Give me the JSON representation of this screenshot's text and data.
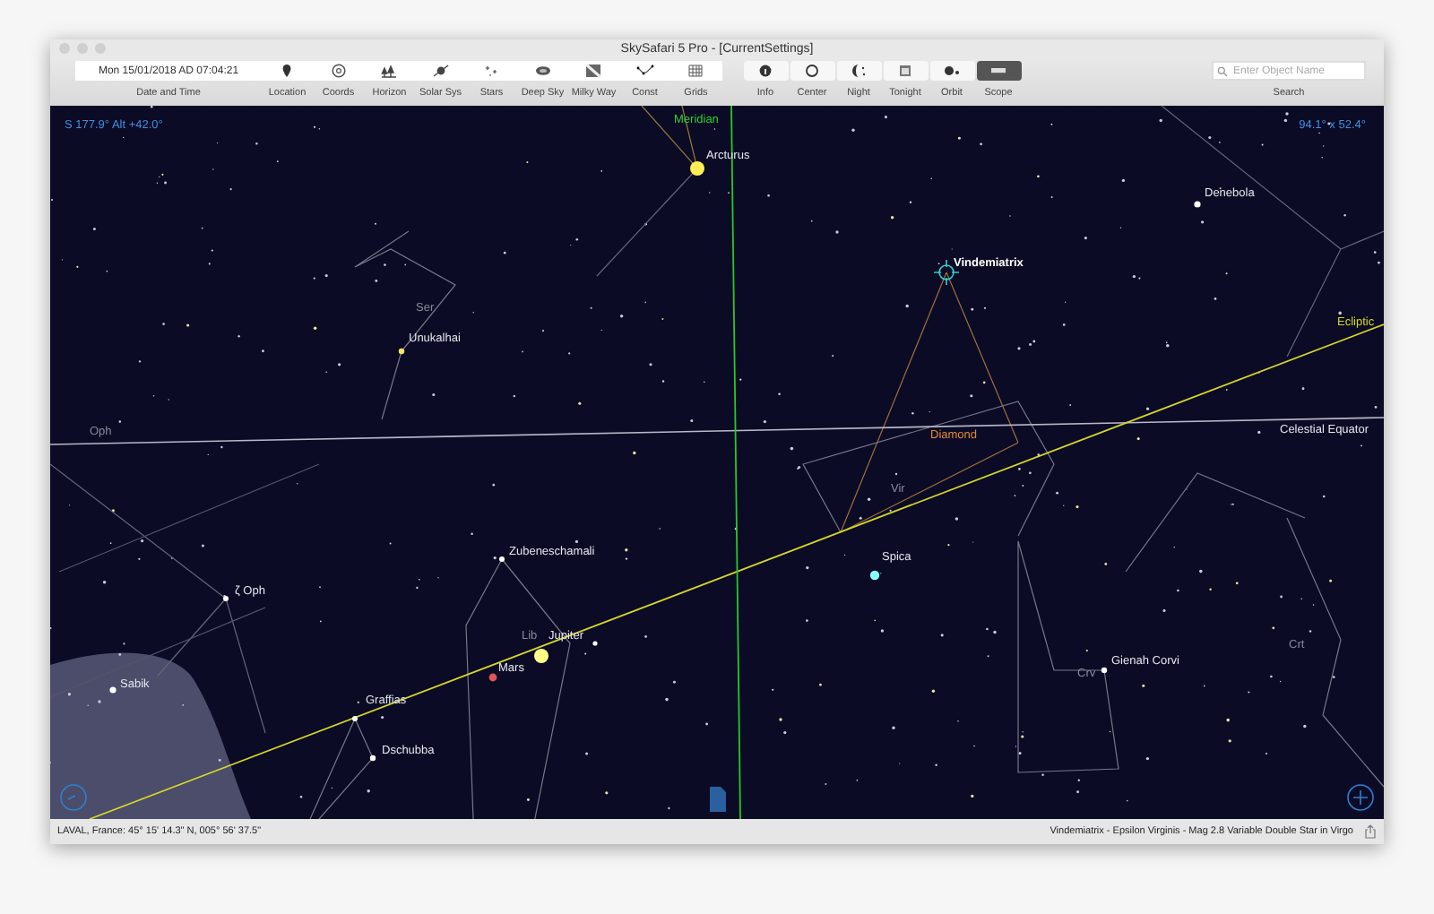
{
  "window": {
    "title": "SkySafari 5 Pro - [CurrentSettings]"
  },
  "toolbar": {
    "date_time": {
      "value": "Mon 15/01/2018 AD 07:04:21",
      "label": "Date and Time"
    },
    "view_buttons": [
      {
        "label": "Location",
        "selected": false
      },
      {
        "label": "Coords",
        "selected": false
      },
      {
        "label": "Horizon",
        "selected": false
      },
      {
        "label": "Solar Sys",
        "selected": false
      },
      {
        "label": "Stars",
        "selected": false
      },
      {
        "label": "Deep Sky",
        "selected": false
      },
      {
        "label": "Milky Way",
        "selected": false
      },
      {
        "label": "Const",
        "selected": false
      },
      {
        "label": "Grids",
        "selected": false
      }
    ],
    "tool_buttons": [
      {
        "label": "Info",
        "selected": false
      },
      {
        "label": "Center",
        "selected": false
      },
      {
        "label": "Night",
        "selected": false
      },
      {
        "label": "Tonight",
        "selected": false
      },
      {
        "label": "Orbit",
        "selected": false
      },
      {
        "label": "Scope",
        "selected": true
      }
    ],
    "search": {
      "placeholder": "Enter Object Name",
      "label": "Search"
    }
  },
  "sky": {
    "orientation": "S 177.9° Alt +42.0°",
    "field_of_view": "94.1° x 52.4°",
    "labels": [
      {
        "text": "Meridian",
        "kind": "meridian"
      },
      {
        "text": "Arcturus",
        "kind": "star"
      },
      {
        "text": "Denebola",
        "kind": "star"
      },
      {
        "text": "Vindemiatrix",
        "kind": "target"
      },
      {
        "text": "Ser",
        "kind": "constellation"
      },
      {
        "text": "Unukalhai",
        "kind": "star"
      },
      {
        "text": "Ecliptic",
        "kind": "ecliptic"
      },
      {
        "text": "Oph",
        "kind": "constellation"
      },
      {
        "text": "Diamond",
        "kind": "asterism"
      },
      {
        "text": "Celestial Equator",
        "kind": "equator"
      },
      {
        "text": "Vir",
        "kind": "constellation"
      },
      {
        "text": "ζ Oph",
        "kind": "star"
      },
      {
        "text": "Zubeneschamali",
        "kind": "star"
      },
      {
        "text": "Spica",
        "kind": "star"
      },
      {
        "text": "Lib",
        "kind": "constellation"
      },
      {
        "text": "Jupiter",
        "kind": "planet"
      },
      {
        "text": "Mars",
        "kind": "planet"
      },
      {
        "text": "Gienah Corvi",
        "kind": "star"
      },
      {
        "text": "Crv",
        "kind": "constellation"
      },
      {
        "text": "Crt",
        "kind": "constellation"
      },
      {
        "text": "Sabik",
        "kind": "star"
      },
      {
        "text": "Graffias",
        "kind": "star"
      },
      {
        "text": "Dschubba",
        "kind": "star"
      }
    ]
  },
  "status_bar": {
    "location": "LAVAL, France: 45° 15' 14.3\" N, 005° 56' 37.5\"",
    "object_info": "Vindemiatrix - Epsilon Virginis - Mag 2.8 Variable Double Star in Virgo"
  }
}
